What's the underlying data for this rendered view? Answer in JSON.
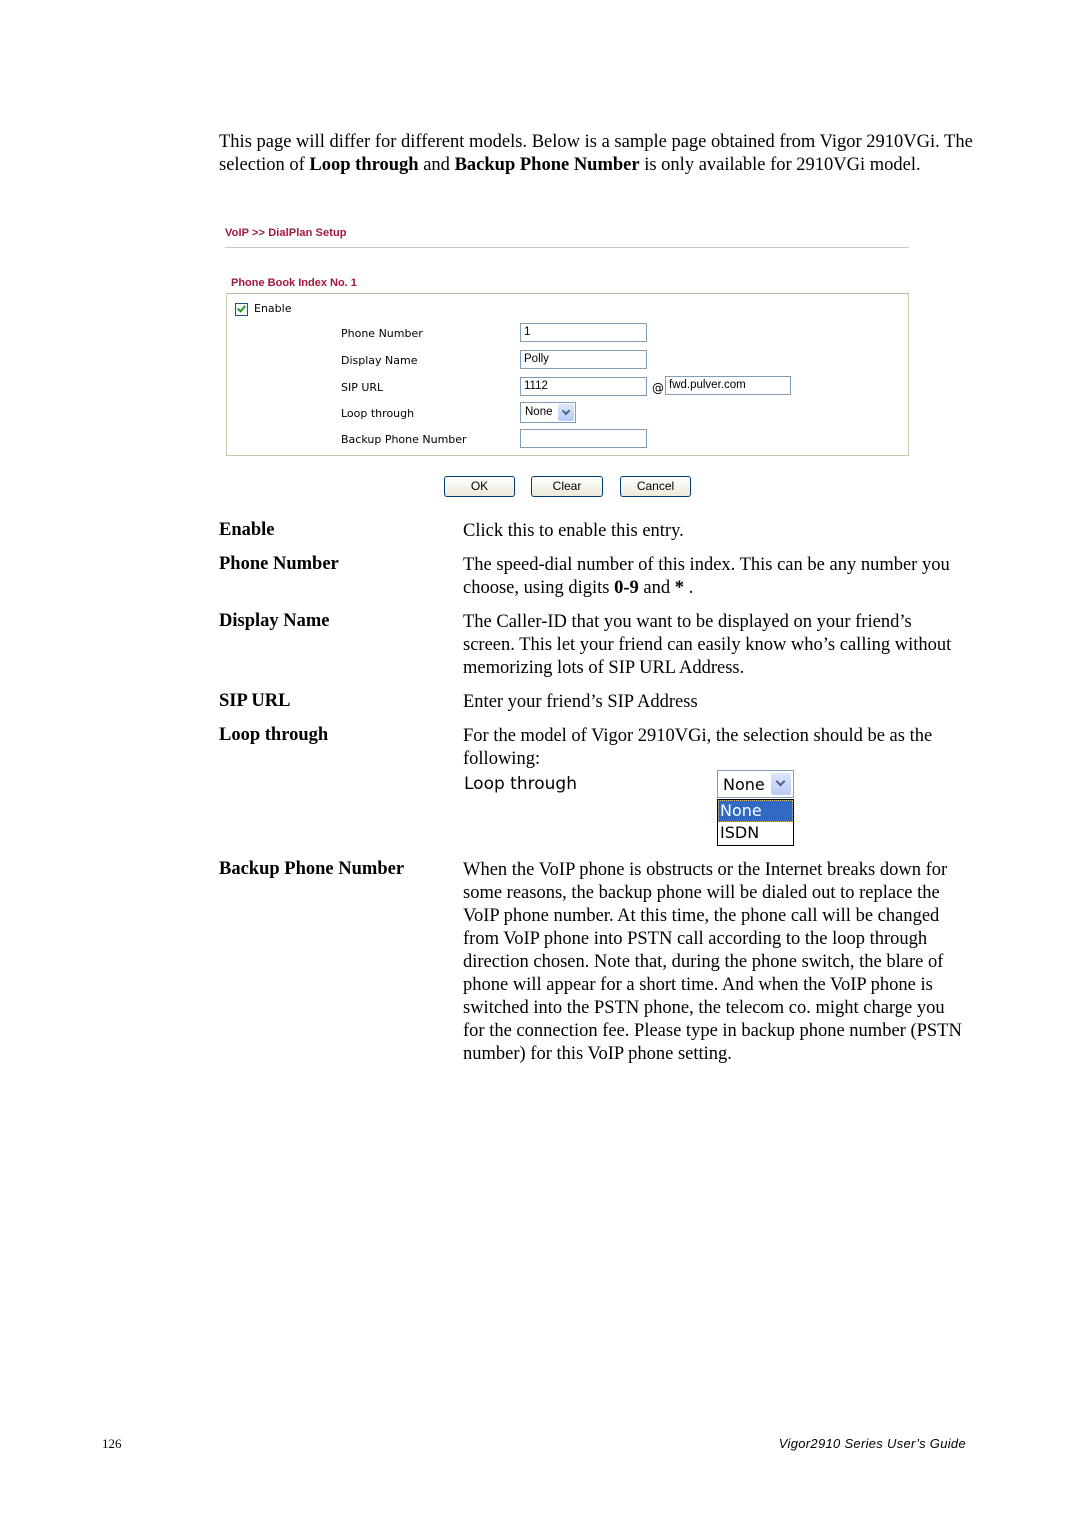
{
  "intro": {
    "part1": "This page will differ for different models. Below is a sample page obtained from Vigor 2910VGi. The selection of ",
    "bold1": "Loop through",
    "part2": " and ",
    "bold2": "Backup Phone Number",
    "part3": " is only available for 2910VGi model."
  },
  "screenshot": {
    "breadcrumb": "VoIP >> DialPlan Setup",
    "section_title": "Phone Book Index No. 1",
    "enable_label": "Enable",
    "enable_checked": true,
    "fields": {
      "phone_number": {
        "label": "Phone Number",
        "value": "1"
      },
      "display_name": {
        "label": "Display Name",
        "value": "Polly"
      },
      "sip_url": {
        "label": "SIP URL",
        "value": "1112",
        "at": "@",
        "domain": "fwd.pulver.com"
      },
      "loop_through": {
        "label": "Loop through",
        "selected": "None"
      },
      "backup_phone": {
        "label": "Backup Phone Number",
        "value": ""
      }
    },
    "buttons": {
      "ok": "OK",
      "clear": "Clear",
      "cancel": "Cancel"
    }
  },
  "definitions": [
    {
      "term": "Enable",
      "desc": "Click this to enable this entry."
    },
    {
      "term": "Phone Number",
      "desc_pre": "The speed-dial number of this index. This can be any number you choose, using digits ",
      "desc_bold": "0-9",
      "desc_mid": " and ",
      "desc_bold2": "*",
      "desc_post": " ."
    },
    {
      "term": "Display Name",
      "desc": "The Caller-ID that you want to be displayed on your friend’s screen. This let your friend can easily know who’s calling without memorizing lots of SIP URL Address."
    },
    {
      "term": "SIP URL",
      "desc": "Enter your friend’s SIP Address"
    },
    {
      "term": "Loop through",
      "desc": "For the model of Vigor 2910VGi, the selection should be as the following:"
    },
    {
      "term": "Backup Phone Number",
      "desc": "When the VoIP phone is obstructs or the Internet breaks down for some reasons, the backup phone will be dialed out to replace the VoIP phone number. At this time, the phone call will be changed from VoIP phone into PSTN call according to the loop through direction chosen. Note that, during the phone switch, the blare of phone will appear for a short time. And when the VoIP phone is switched into the PSTN phone, the telecom co. might charge you for the connection fee. Please type in backup phone number (PSTN number) for this VoIP phone setting."
    }
  ],
  "loop_through_example": {
    "label": "Loop through",
    "selected": "None",
    "options": [
      "None",
      "ISDN"
    ],
    "highlighted": "None"
  },
  "footer": {
    "page_number": "126",
    "guide_title": "Vigor2910 Series User’s Guide"
  },
  "colors": {
    "heading": "#a3173d",
    "selection": "#316ac5",
    "field_border": "#7f9db9"
  }
}
